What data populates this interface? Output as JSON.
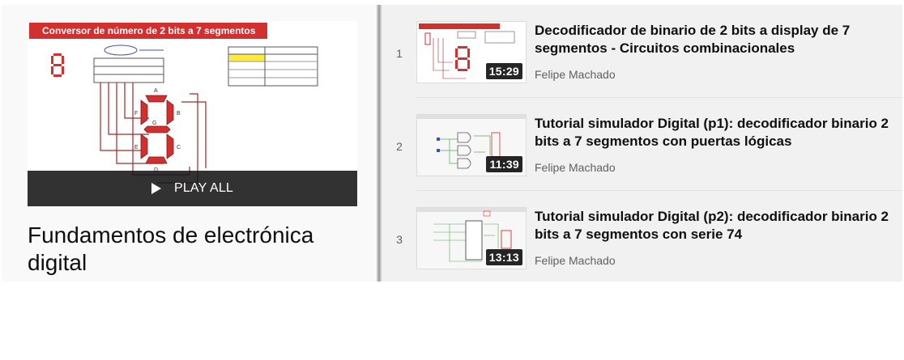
{
  "playlist": {
    "hero_banner": "Conversor de número de 2 bits a 7 segmentos",
    "play_all_label": "PLAY ALL",
    "title": "Fundamentos de electrónica digital"
  },
  "videos": [
    {
      "index": "1",
      "title": "Decodificador de binario de 2 bits a display de 7 segmentos - Circuitos combinacionales",
      "channel": "Felipe Machado",
      "duration": "15:29"
    },
    {
      "index": "2",
      "title": "Tutorial simulador Digital (p1): decodificador binario 2 bits a 7 segmentos con puertas lógicas",
      "channel": "Felipe Machado",
      "duration": "11:39"
    },
    {
      "index": "3",
      "title": "Tutorial simulador Digital (p2): decodificador binario 2 bits a 7 segmentos con serie 74",
      "channel": "Felipe Machado",
      "duration": "13:13"
    }
  ],
  "colors": {
    "accent_red": "#d32f2f",
    "text_primary": "#0f0f0f",
    "text_secondary": "#606060"
  },
  "icons": {
    "play": "play-icon"
  }
}
